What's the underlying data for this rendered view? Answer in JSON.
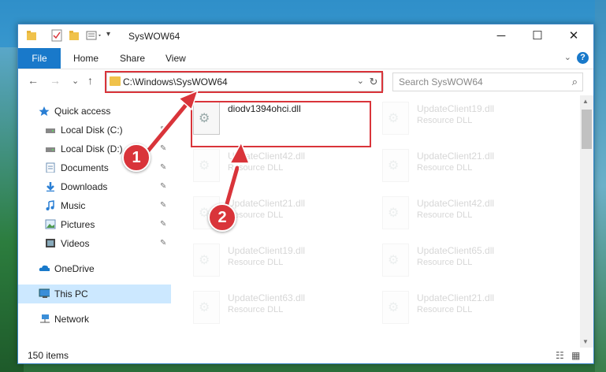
{
  "window": {
    "title": "SysWOW64",
    "minimize": "─",
    "maximize": "☐",
    "close": "✕"
  },
  "quick_access_icons": [
    "folder-icon",
    "properties-icon",
    "new-folder-icon",
    "customize-icon"
  ],
  "ribbon": {
    "tabs": [
      "File",
      "Home",
      "Share",
      "View"
    ],
    "expand": "⌄",
    "help": "?"
  },
  "nav": {
    "back": "←",
    "forward": "→",
    "recent": "⌄",
    "up": "↑",
    "address": "C:\\Windows\\SysWOW64",
    "address_dropdown": "⌄",
    "refresh": "↻",
    "search_placeholder": "Search SysWOW64",
    "search_icon": "⌕"
  },
  "sidebar": {
    "items": [
      {
        "label": "Quick access",
        "icon": "star-icon",
        "pinned": false
      },
      {
        "label": "Local Disk (C:)",
        "icon": "drive-icon",
        "pinned": true
      },
      {
        "label": "Local Disk (D:)",
        "icon": "drive-icon",
        "pinned": true
      },
      {
        "label": "Documents",
        "icon": "documents-icon",
        "pinned": true
      },
      {
        "label": "Downloads",
        "icon": "downloads-icon",
        "pinned": true
      },
      {
        "label": "Music",
        "icon": "music-icon",
        "pinned": true
      },
      {
        "label": "Pictures",
        "icon": "pictures-icon",
        "pinned": true
      },
      {
        "label": "Videos",
        "icon": "videos-icon",
        "pinned": true
      },
      {
        "label": "OneDrive",
        "icon": "onedrive-icon",
        "pinned": false
      },
      {
        "label": "This PC",
        "icon": "computer-icon",
        "pinned": false,
        "selected": true
      },
      {
        "label": "Network",
        "icon": "network-icon",
        "pinned": false
      }
    ],
    "pin_glyph": "📌"
  },
  "files": [
    {
      "name": "diodv1394ohci.dll",
      "type": "",
      "highlight": true
    },
    {
      "name": "UpdateClient19.dll",
      "type": "Resource DLL"
    },
    {
      "name": "UpdateClient42.dll",
      "type": "Resource DLL"
    },
    {
      "name": "UpdateClient21.dll",
      "type": "Resource DLL"
    },
    {
      "name": "UpdateClient21.dll",
      "type": "Resource DLL"
    },
    {
      "name": "UpdateClient42.dll",
      "type": "Resource DLL"
    },
    {
      "name": "UpdateClient19.dll",
      "type": "Resource DLL"
    },
    {
      "name": "UpdateClient65.dll",
      "type": "Resource DLL"
    },
    {
      "name": "UpdateClient63.dll",
      "type": "Resource DLL"
    },
    {
      "name": "UpdateClient21.dll",
      "type": "Resource DLL"
    }
  ],
  "status": {
    "items": "150 items"
  },
  "annotations": {
    "step1": "1",
    "step2": "2"
  },
  "colors": {
    "accent": "#1979ca",
    "annotation_red": "#d9343a"
  }
}
